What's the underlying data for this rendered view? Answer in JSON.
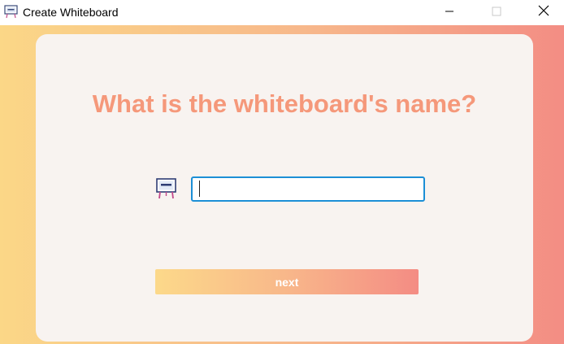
{
  "window": {
    "title": "Create Whiteboard",
    "icon": "whiteboard-icon",
    "controls": {
      "minimize_icon": "minimize-icon",
      "maximize_icon": "maximize-icon",
      "close_icon": "close-icon"
    }
  },
  "main": {
    "heading": "What is the whiteboard's name?",
    "name_field": {
      "icon": "whiteboard-icon",
      "value": "",
      "placeholder": ""
    },
    "next_label": "next"
  },
  "colors": {
    "heading": "#f5987a",
    "gradient_start": "#fbd787",
    "gradient_end": "#f38d84",
    "card_background": "#f8f3f0",
    "input_focus_border": "#1c8fd6"
  }
}
